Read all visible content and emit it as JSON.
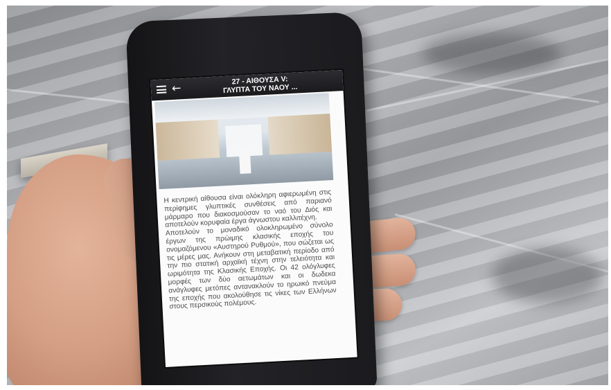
{
  "scene": {
    "description_free": true
  },
  "app": {
    "header": {
      "title": "27 - ΑΙΘΟΥΣΑ V:\nΓΛΥΠΤΑ ΤΟΥ ΝΑΟΥ ...",
      "menu_icon": "hamburger-menu-icon",
      "back_icon": "back-arrow-icon"
    },
    "body": {
      "paragraph": "Η κεντρική αίθουσα είναι ολόκληρη αφιερωμένη στις περίφημες γλυπτικές συνθέσεις από παριανό μάρμαρο που διακοσμούσαν το ναό του Διός και αποτελούν κορυφαία έργα άγνωστου καλλιτέχνη.\nΑποτελούν το μοναδικό ολοκληρωμένο σύνολο έργων της πρώιμης κλασικής εποχής του ονομαζόμενου «Αυστηρού Ρυθμού», που σώζεται ως τις μέρες μας. Ανήκουν στη μεταβατική περίοδο από την πιο στατική αρχαϊκή τέχνη στην τελειότητα και ωριμότητα της Κλασικής Εποχής. Οι 42 ολόγλυφες μορφές των δύο αετωμάτων και οι δωδεκα ανάγλυφες μετόπες αντανακλούν το ηρωικό πνεύμα της εποχής που ακολούθησε τις νίκες των Ελλήνων στους περσικούς πολέμους."
    }
  }
}
